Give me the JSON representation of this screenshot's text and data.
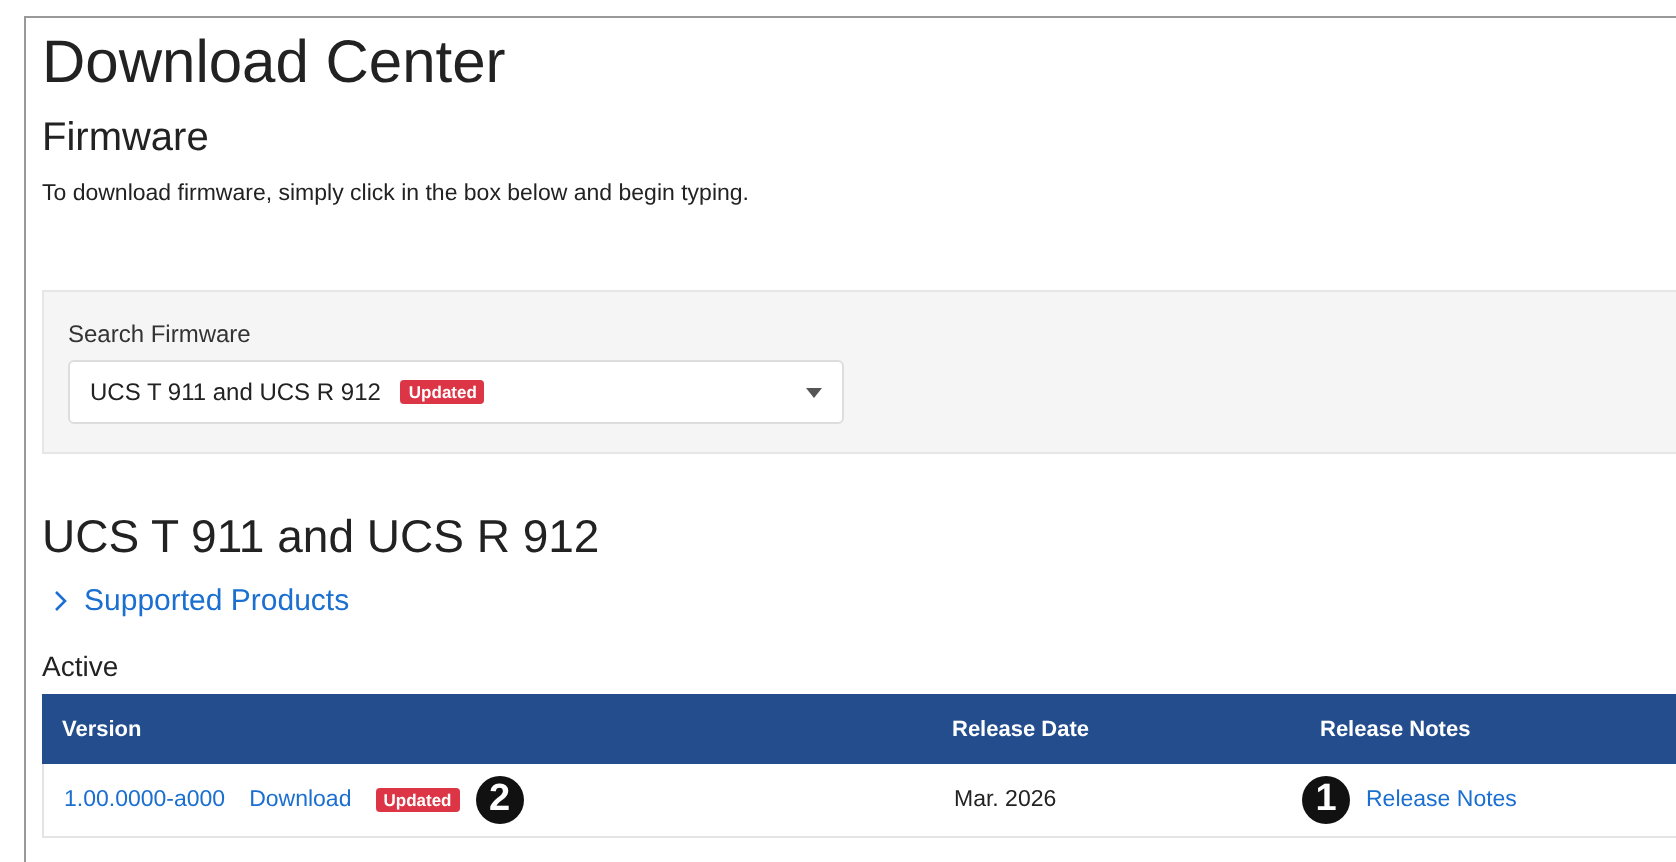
{
  "title": "Download Center",
  "section": "Firmware",
  "intro": "To download firmware, simply click in the box below and begin typing.",
  "search": {
    "label": "Search Firmware",
    "value": "UCS T 911 and UCS R 912",
    "badge": "Updated"
  },
  "product": {
    "title": "UCS T 911 and UCS R 912",
    "supported": {
      "label": "Supported Products",
      "expanded": false
    }
  },
  "group": "Active",
  "table": {
    "columns": [
      "Version",
      "Release Date",
      "Release Notes"
    ],
    "rows": [
      {
        "version": "1.00.0000-a000",
        "download": "Download",
        "badge": "Updated",
        "callout_a": "2",
        "date": "Mar. 2026",
        "callout_b": "1",
        "notes": "Release Notes"
      }
    ]
  }
}
